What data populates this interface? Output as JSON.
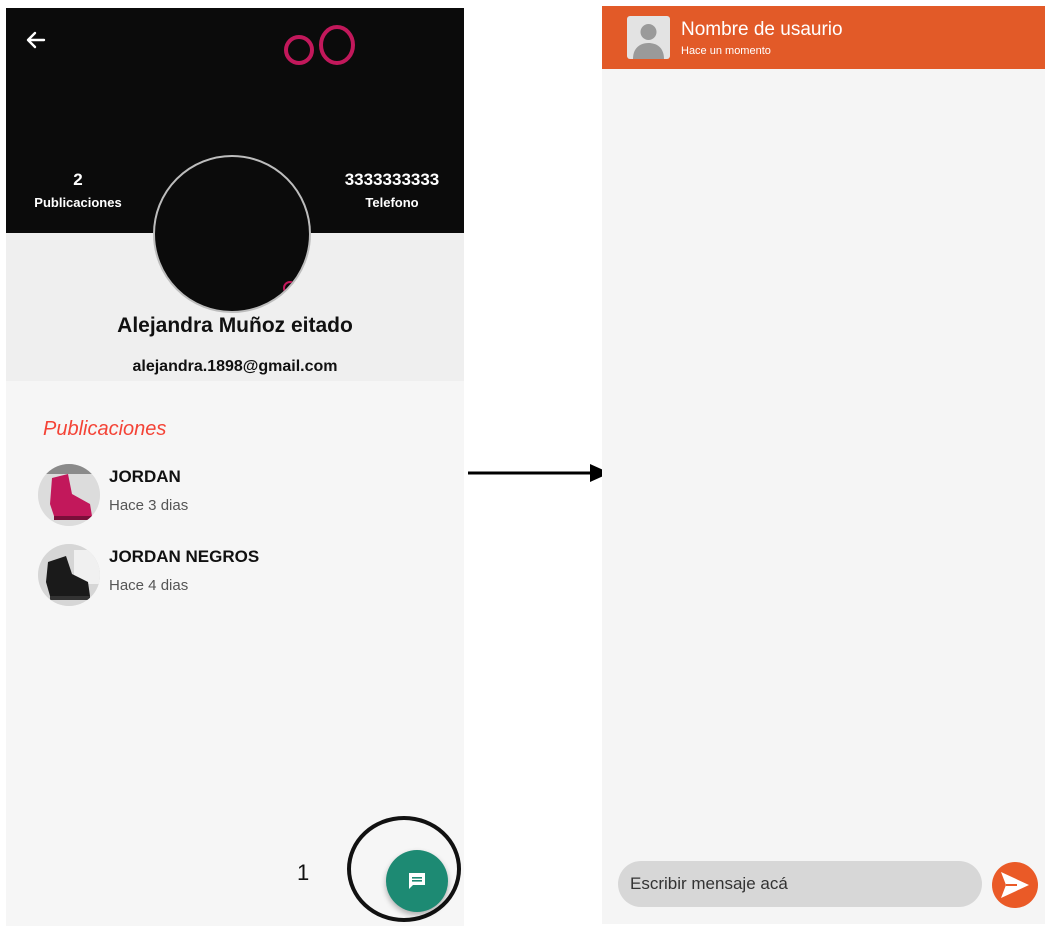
{
  "profile_screen": {
    "logo_text": "oO",
    "stats": {
      "posts_count": "2",
      "posts_label": "Publicaciones",
      "phone": "3333333333",
      "phone_label": "Telefono"
    },
    "name": "Alejandra Muñoz eitado",
    "email": "alejandra.1898@gmail.com",
    "section_title": "Publicaciones",
    "posts": [
      {
        "title": "JORDAN",
        "time": "Hace 3 dias",
        "thumb_color": "#c2185b"
      },
      {
        "title": "JORDAN NEGROS",
        "time": "Hace 4 dias",
        "thumb_color": "#1a1a1a"
      }
    ],
    "fab_annotation": "1",
    "colors": {
      "header_bg": "#0b0b0b",
      "accent": "#f44336",
      "fab": "#1d8a73",
      "logo": "#c2185b"
    }
  },
  "chat_screen": {
    "username": "Nombre de usaurio",
    "status": "Hace un momento",
    "input_placeholder": "Escribir mensaje acá",
    "colors": {
      "header_bg": "#e25a28",
      "send": "#ea5a27"
    }
  }
}
